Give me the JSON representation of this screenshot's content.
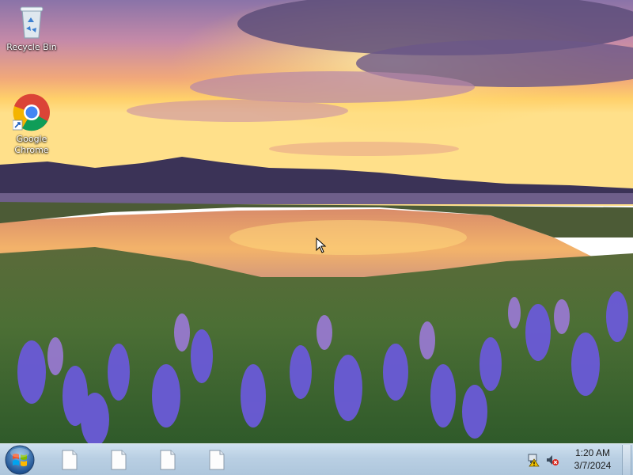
{
  "desktop": {
    "icons": [
      {
        "label": "Recycle Bin",
        "icon": "recycle-bin-icon"
      },
      {
        "label": "Google\nChrome",
        "icon": "chrome-icon"
      }
    ]
  },
  "taskbar": {
    "start_icon": "windows-logo-icon",
    "items": [
      {
        "icon": "blank-document-icon"
      },
      {
        "icon": "blank-document-icon"
      },
      {
        "icon": "blank-document-icon"
      },
      {
        "icon": "blank-document-icon"
      }
    ],
    "tray": {
      "network_icon": "network-warning-icon",
      "volume_icon": "volume-muted-icon",
      "time": "1:20 AM",
      "date": "3/7/2024"
    }
  },
  "colors": {
    "taskbar": "#b9cfe3",
    "sky_top": "#7f6fa8",
    "sky_glow": "#ffcf5a",
    "flowers": "#6a5ad8"
  }
}
